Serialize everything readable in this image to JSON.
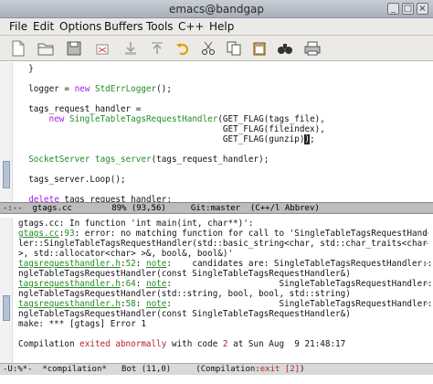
{
  "window": {
    "title": "emacs@bandgap"
  },
  "menubar": {
    "items": [
      "File",
      "Edit",
      "Options",
      "Buffers",
      "Tools",
      "C++",
      "Help"
    ]
  },
  "toolbar": {
    "icons": [
      "new-file-icon",
      "open-folder-icon",
      "save-icon",
      "cut-icon",
      "copy-icon",
      "paste-icon",
      "undo-icon",
      "cut-scissors-icon",
      "copy-pages-icon",
      "paste-clipboard-icon",
      "search-binoculars-icon",
      "print-icon"
    ]
  },
  "editor": {
    "lines": [
      "  }",
      "",
      "  logger = new StdErrLogger();",
      "",
      "  tags_request_handler =",
      "      new SingleTableTagsRequestHandler(GET_FLAG(tags_file),",
      "                                        GET_FLAG(fileindex),",
      "                                        GET_FLAG(gunzip));",
      "",
      "  SocketServer tags_server(tags_request_handler);",
      "",
      "  tags_server.Loop();",
      "",
      "  delete tags_request_handler;"
    ]
  },
  "modeline_top": {
    "text": "-:--  gtags.cc        89% (93,56)     Git:master  (C++/l Abbrev)"
  },
  "compile": {
    "lines": [
      "gtags.cc: In function 'int main(int, char**)':",
      "gtags.cc:93: error: no matching function for call to 'SingleTableTagsRequestHand",
      "ler::SingleTableTagsRequestHandler(std::basic_string<char, std::char_traits<char",
      ">, std::allocator<char> >&, bool&, bool&)'",
      "tagsrequesthandler.h:52: note:    candidates are: SingleTableTagsRequestHandler::Si",
      "ngleTableTagsRequestHandler(const SingleTableTagsRequestHandler&)",
      "tagsrequesthandler.h:64: note:                     SingleTableTagsRequestHandler::Si",
      "ngleTableTagsRequestHandler(std::string, bool, bool, std::string)",
      "tagsrequesthandler.h:58: note:                     SingleTableTagsRequestHandler::Si",
      "ngleTableTagsRequestHandler(const SingleTableTagsRequestHandler&)",
      "make: *** [gtags] Error 1",
      "",
      "Compilation exited abnormally with code 2 at Sun Aug  9 21:48:17"
    ]
  },
  "modeline_bottom": {
    "text": "-U:%*-  *compilation*   Bot (11,0)     (Compilation:exit [2])"
  },
  "colors": {
    "keyword": "#a020f0",
    "type": "#228b22",
    "error": "#b22222"
  }
}
